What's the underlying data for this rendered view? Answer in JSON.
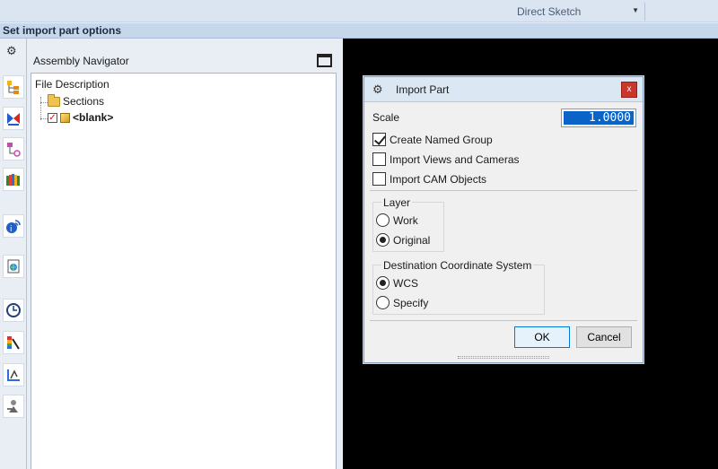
{
  "topbar": {
    "mode_label": "Direct Sketch"
  },
  "cue": {
    "text": "Set import part options"
  },
  "resource_bar": {
    "buttons": [
      "assembly-navigator-icon",
      "constraint-navigator-icon",
      "part-navigator-icon",
      "reuse-library-icon",
      "hd3d-tools-icon",
      "web-browser-icon",
      "history-icon",
      "visualization-icon",
      "process-studio-icon",
      "roles-icon"
    ]
  },
  "navigator": {
    "title": "Assembly Navigator",
    "column_header": "File Description",
    "items": [
      {
        "label": "Sections",
        "icon": "folder-icon"
      },
      {
        "label": "<blank>",
        "icon": "part-icon",
        "checked": true
      }
    ]
  },
  "dialog": {
    "title": "Import Part",
    "close_label": "x",
    "scale_label": "Scale",
    "scale_value": "1.0000",
    "options": [
      {
        "label": "Create Named Group",
        "checked": true
      },
      {
        "label": "Import Views and Cameras",
        "checked": false
      },
      {
        "label": "Import CAM Objects",
        "checked": false
      }
    ],
    "layer": {
      "legend": "Layer",
      "options": [
        {
          "label": "Work",
          "selected": false
        },
        {
          "label": "Original",
          "selected": true
        }
      ]
    },
    "dest_cs": {
      "legend": "Destination Coordinate System",
      "options": [
        {
          "label": "WCS",
          "selected": true
        },
        {
          "label": "Specify",
          "selected": false
        }
      ]
    },
    "ok_label": "OK",
    "cancel_label": "Cancel"
  }
}
